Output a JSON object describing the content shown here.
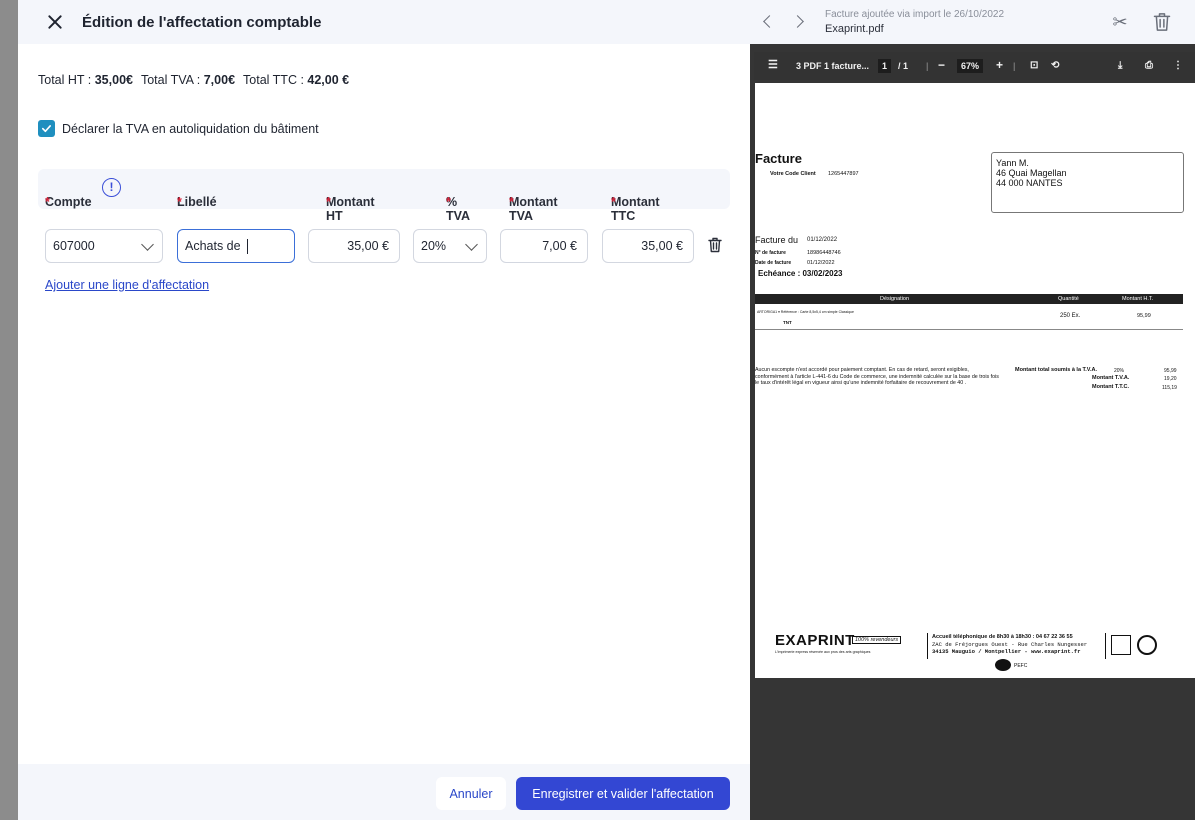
{
  "header": {
    "title": "Édition de l'affectation comptable"
  },
  "totals": {
    "ht_label": "Total HT : ",
    "ht_value": "35,00€",
    "tva_label": "Total TVA : ",
    "tva_value": "7,00€",
    "ttc_label": "Total TTC : ",
    "ttc_value": "42,00 €"
  },
  "autoliquidation": {
    "label": "Déclarer la TVA en autoliquidation du bâtiment",
    "checked": true
  },
  "table": {
    "columns": [
      "Compte",
      "Libellé",
      "Montant HT",
      "% TVA",
      "Montant TVA",
      "Montant TTC"
    ],
    "info_glyph": "!",
    "row": {
      "compte": "607000",
      "libelle": "Achats de",
      "montant_ht": "35,00 €",
      "tva_rate": "20%",
      "montant_tva": "7,00 €",
      "montant_ttc": "35,00 €"
    },
    "add_link": "Ajouter une ligne d'affectation"
  },
  "footer": {
    "cancel": "Annuler",
    "save": "Enregistrer et valider l'affectation"
  },
  "viewer": {
    "import_note": "Facture ajoutée via import le 26/10/2022",
    "file_name": "Exaprint.pdf",
    "pdf_toolbar": {
      "doc_title": "3 PDF 1 facture...",
      "page_current": "1",
      "page_total": "/ 1",
      "zoom": "67%"
    },
    "invoice": {
      "heading": "Facture",
      "client_code_label": "Votre Code Client",
      "client_code": "1265447897",
      "addr_name": "Yann M.",
      "addr_line1": "46 Quai Magellan",
      "addr_line2": "44 000 NANTES",
      "date_label": "Facture du",
      "date_value": "01/12/2022",
      "number_label": "N° de facture",
      "number_value": "18986448746",
      "date_facture_label": "Date de facture",
      "date_facture_value": "01/12/2022",
      "echeance": "Echéance : 03/02/2023",
      "col_designation": "Désignation",
      "col_quantite": "Quantité",
      "col_montant": "Montant H.T.",
      "line_ref": "ARTORIGA1 ▾ Référence : Carte 8,5x5,4 cm simple Classique",
      "line_tnt": "TNT",
      "line_qty": "250 Ex.",
      "line_amount": "95,99",
      "conditions": "Aucun escompte n'est accordé pour paiement comptant. En cas de retard, seront exigibles, conformément à l'article L-441-6 du Code de commerce, une indemnité calculée sur la base de trois fois le taux d'intérêt légal en vigueur ainsi qu'une indemnité forfaitaire de recouvrement de 40 .",
      "total_label": "Montant total soumis à la T.V.A.",
      "total_rate": "20%",
      "total_ht": "95,99",
      "tva_label": "Montant T.V.A.",
      "tva_value": "19,20",
      "ttc_label": "Montant T.T.C.",
      "ttc_value": "115,19",
      "brand": "EXAPRINT",
      "brand_badge": "100% revendeurs",
      "brand_tagline": "L'imprimerie express réservée aux pros des arts graphiques",
      "contact_1": "Accueil téléphonique de 8h30 à 18h30 : 04 67 22 36 55",
      "contact_2": "ZAC de Fréjorgues Ouest - Rue Charles Nungesser",
      "contact_3": "34135 Mauguio / Montpellier - www.exaprint.fr",
      "pefc": "PEFC"
    }
  }
}
